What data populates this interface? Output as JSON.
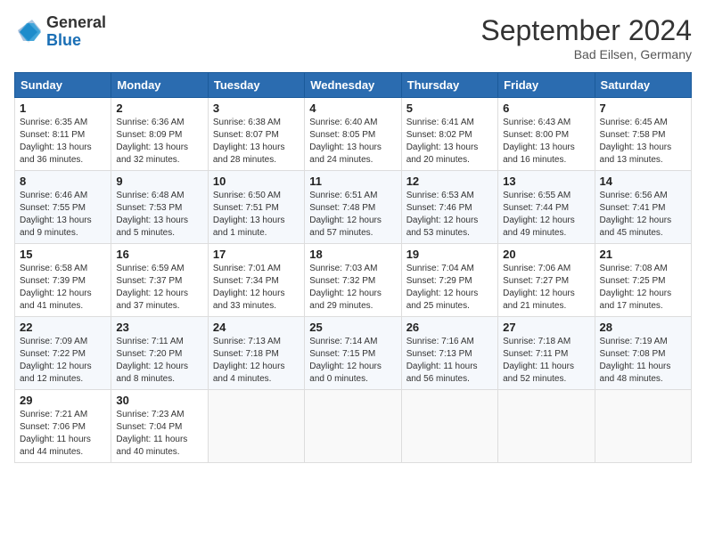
{
  "header": {
    "logo_general": "General",
    "logo_blue": "Blue",
    "month_title": "September 2024",
    "location": "Bad Eilsen, Germany"
  },
  "weekdays": [
    "Sunday",
    "Monday",
    "Tuesday",
    "Wednesday",
    "Thursday",
    "Friday",
    "Saturday"
  ],
  "weeks": [
    [
      {
        "day": "1",
        "info": "Sunrise: 6:35 AM\nSunset: 8:11 PM\nDaylight: 13 hours\nand 36 minutes."
      },
      {
        "day": "2",
        "info": "Sunrise: 6:36 AM\nSunset: 8:09 PM\nDaylight: 13 hours\nand 32 minutes."
      },
      {
        "day": "3",
        "info": "Sunrise: 6:38 AM\nSunset: 8:07 PM\nDaylight: 13 hours\nand 28 minutes."
      },
      {
        "day": "4",
        "info": "Sunrise: 6:40 AM\nSunset: 8:05 PM\nDaylight: 13 hours\nand 24 minutes."
      },
      {
        "day": "5",
        "info": "Sunrise: 6:41 AM\nSunset: 8:02 PM\nDaylight: 13 hours\nand 20 minutes."
      },
      {
        "day": "6",
        "info": "Sunrise: 6:43 AM\nSunset: 8:00 PM\nDaylight: 13 hours\nand 16 minutes."
      },
      {
        "day": "7",
        "info": "Sunrise: 6:45 AM\nSunset: 7:58 PM\nDaylight: 13 hours\nand 13 minutes."
      }
    ],
    [
      {
        "day": "8",
        "info": "Sunrise: 6:46 AM\nSunset: 7:55 PM\nDaylight: 13 hours\nand 9 minutes."
      },
      {
        "day": "9",
        "info": "Sunrise: 6:48 AM\nSunset: 7:53 PM\nDaylight: 13 hours\nand 5 minutes."
      },
      {
        "day": "10",
        "info": "Sunrise: 6:50 AM\nSunset: 7:51 PM\nDaylight: 13 hours\nand 1 minute."
      },
      {
        "day": "11",
        "info": "Sunrise: 6:51 AM\nSunset: 7:48 PM\nDaylight: 12 hours\nand 57 minutes."
      },
      {
        "day": "12",
        "info": "Sunrise: 6:53 AM\nSunset: 7:46 PM\nDaylight: 12 hours\nand 53 minutes."
      },
      {
        "day": "13",
        "info": "Sunrise: 6:55 AM\nSunset: 7:44 PM\nDaylight: 12 hours\nand 49 minutes."
      },
      {
        "day": "14",
        "info": "Sunrise: 6:56 AM\nSunset: 7:41 PM\nDaylight: 12 hours\nand 45 minutes."
      }
    ],
    [
      {
        "day": "15",
        "info": "Sunrise: 6:58 AM\nSunset: 7:39 PM\nDaylight: 12 hours\nand 41 minutes."
      },
      {
        "day": "16",
        "info": "Sunrise: 6:59 AM\nSunset: 7:37 PM\nDaylight: 12 hours\nand 37 minutes."
      },
      {
        "day": "17",
        "info": "Sunrise: 7:01 AM\nSunset: 7:34 PM\nDaylight: 12 hours\nand 33 minutes."
      },
      {
        "day": "18",
        "info": "Sunrise: 7:03 AM\nSunset: 7:32 PM\nDaylight: 12 hours\nand 29 minutes."
      },
      {
        "day": "19",
        "info": "Sunrise: 7:04 AM\nSunset: 7:29 PM\nDaylight: 12 hours\nand 25 minutes."
      },
      {
        "day": "20",
        "info": "Sunrise: 7:06 AM\nSunset: 7:27 PM\nDaylight: 12 hours\nand 21 minutes."
      },
      {
        "day": "21",
        "info": "Sunrise: 7:08 AM\nSunset: 7:25 PM\nDaylight: 12 hours\nand 17 minutes."
      }
    ],
    [
      {
        "day": "22",
        "info": "Sunrise: 7:09 AM\nSunset: 7:22 PM\nDaylight: 12 hours\nand 12 minutes."
      },
      {
        "day": "23",
        "info": "Sunrise: 7:11 AM\nSunset: 7:20 PM\nDaylight: 12 hours\nand 8 minutes."
      },
      {
        "day": "24",
        "info": "Sunrise: 7:13 AM\nSunset: 7:18 PM\nDaylight: 12 hours\nand 4 minutes."
      },
      {
        "day": "25",
        "info": "Sunrise: 7:14 AM\nSunset: 7:15 PM\nDaylight: 12 hours\nand 0 minutes."
      },
      {
        "day": "26",
        "info": "Sunrise: 7:16 AM\nSunset: 7:13 PM\nDaylight: 11 hours\nand 56 minutes."
      },
      {
        "day": "27",
        "info": "Sunrise: 7:18 AM\nSunset: 7:11 PM\nDaylight: 11 hours\nand 52 minutes."
      },
      {
        "day": "28",
        "info": "Sunrise: 7:19 AM\nSunset: 7:08 PM\nDaylight: 11 hours\nand 48 minutes."
      }
    ],
    [
      {
        "day": "29",
        "info": "Sunrise: 7:21 AM\nSunset: 7:06 PM\nDaylight: 11 hours\nand 44 minutes."
      },
      {
        "day": "30",
        "info": "Sunrise: 7:23 AM\nSunset: 7:04 PM\nDaylight: 11 hours\nand 40 minutes."
      },
      {
        "day": "",
        "info": ""
      },
      {
        "day": "",
        "info": ""
      },
      {
        "day": "",
        "info": ""
      },
      {
        "day": "",
        "info": ""
      },
      {
        "day": "",
        "info": ""
      }
    ]
  ]
}
